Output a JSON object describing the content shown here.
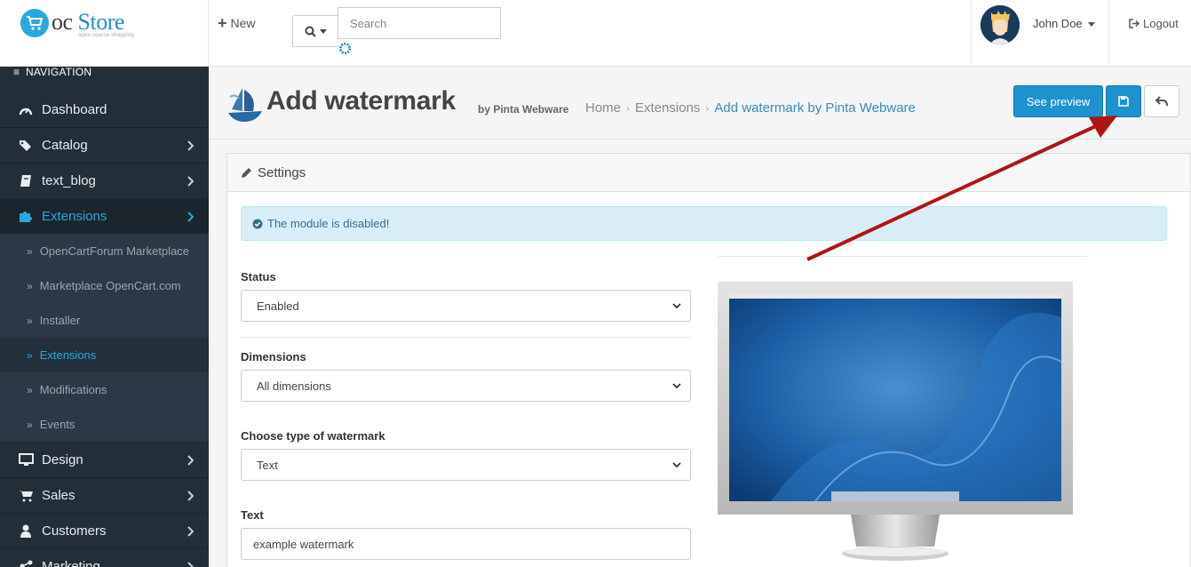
{
  "header": {
    "logo_oc": "oc",
    "logo_store": "Store",
    "logo_tagline": "open source shopping",
    "new_label": "New",
    "search_placeholder": "Search",
    "user_name": "John Doe",
    "logout_label": "Logout"
  },
  "sidebar": {
    "nav_title": "NAVIGATION",
    "items": [
      {
        "label": "Dashboard",
        "icon": "dashboard-icon"
      },
      {
        "label": "Catalog",
        "icon": "tags-icon"
      },
      {
        "label": "text_blog",
        "icon": "book-icon"
      },
      {
        "label": "Extensions",
        "icon": "puzzle-icon"
      },
      {
        "label": "Design",
        "icon": "desktop-icon"
      },
      {
        "label": "Sales",
        "icon": "cart-icon"
      },
      {
        "label": "Customers",
        "icon": "user-icon"
      },
      {
        "label": "Marketing",
        "icon": "share-icon"
      }
    ],
    "subitems": [
      {
        "label": "OpenCartForum Marketplace"
      },
      {
        "label": "Marketplace OpenCart.com"
      },
      {
        "label": "Installer"
      },
      {
        "label": "Extensions"
      },
      {
        "label": "Modifications"
      },
      {
        "label": "Events"
      }
    ]
  },
  "page": {
    "title": "Add watermark",
    "subtitle": "by Pinta Webware",
    "breadcrumb": [
      "Home",
      "Extensions",
      "Add watermark by Pinta Webware"
    ],
    "preview_button": "See preview"
  },
  "panel": {
    "heading": "Settings",
    "alert": "The module is disabled!",
    "fields": [
      {
        "label": "Status",
        "value": "Enabled",
        "type": "select"
      },
      {
        "label": "Dimensions",
        "value": "All dimensions",
        "type": "select"
      },
      {
        "label": "Choose type of watermark",
        "value": "Text",
        "type": "select"
      },
      {
        "label": "Text",
        "value": "example watermark",
        "type": "input"
      }
    ]
  },
  "colors": {
    "primary": "#1e91cf",
    "sidebar_bg": "#222e38",
    "sidebar_active": "#2aa7de",
    "alert_bg": "#d9edf7",
    "arrow": "#b01515"
  }
}
